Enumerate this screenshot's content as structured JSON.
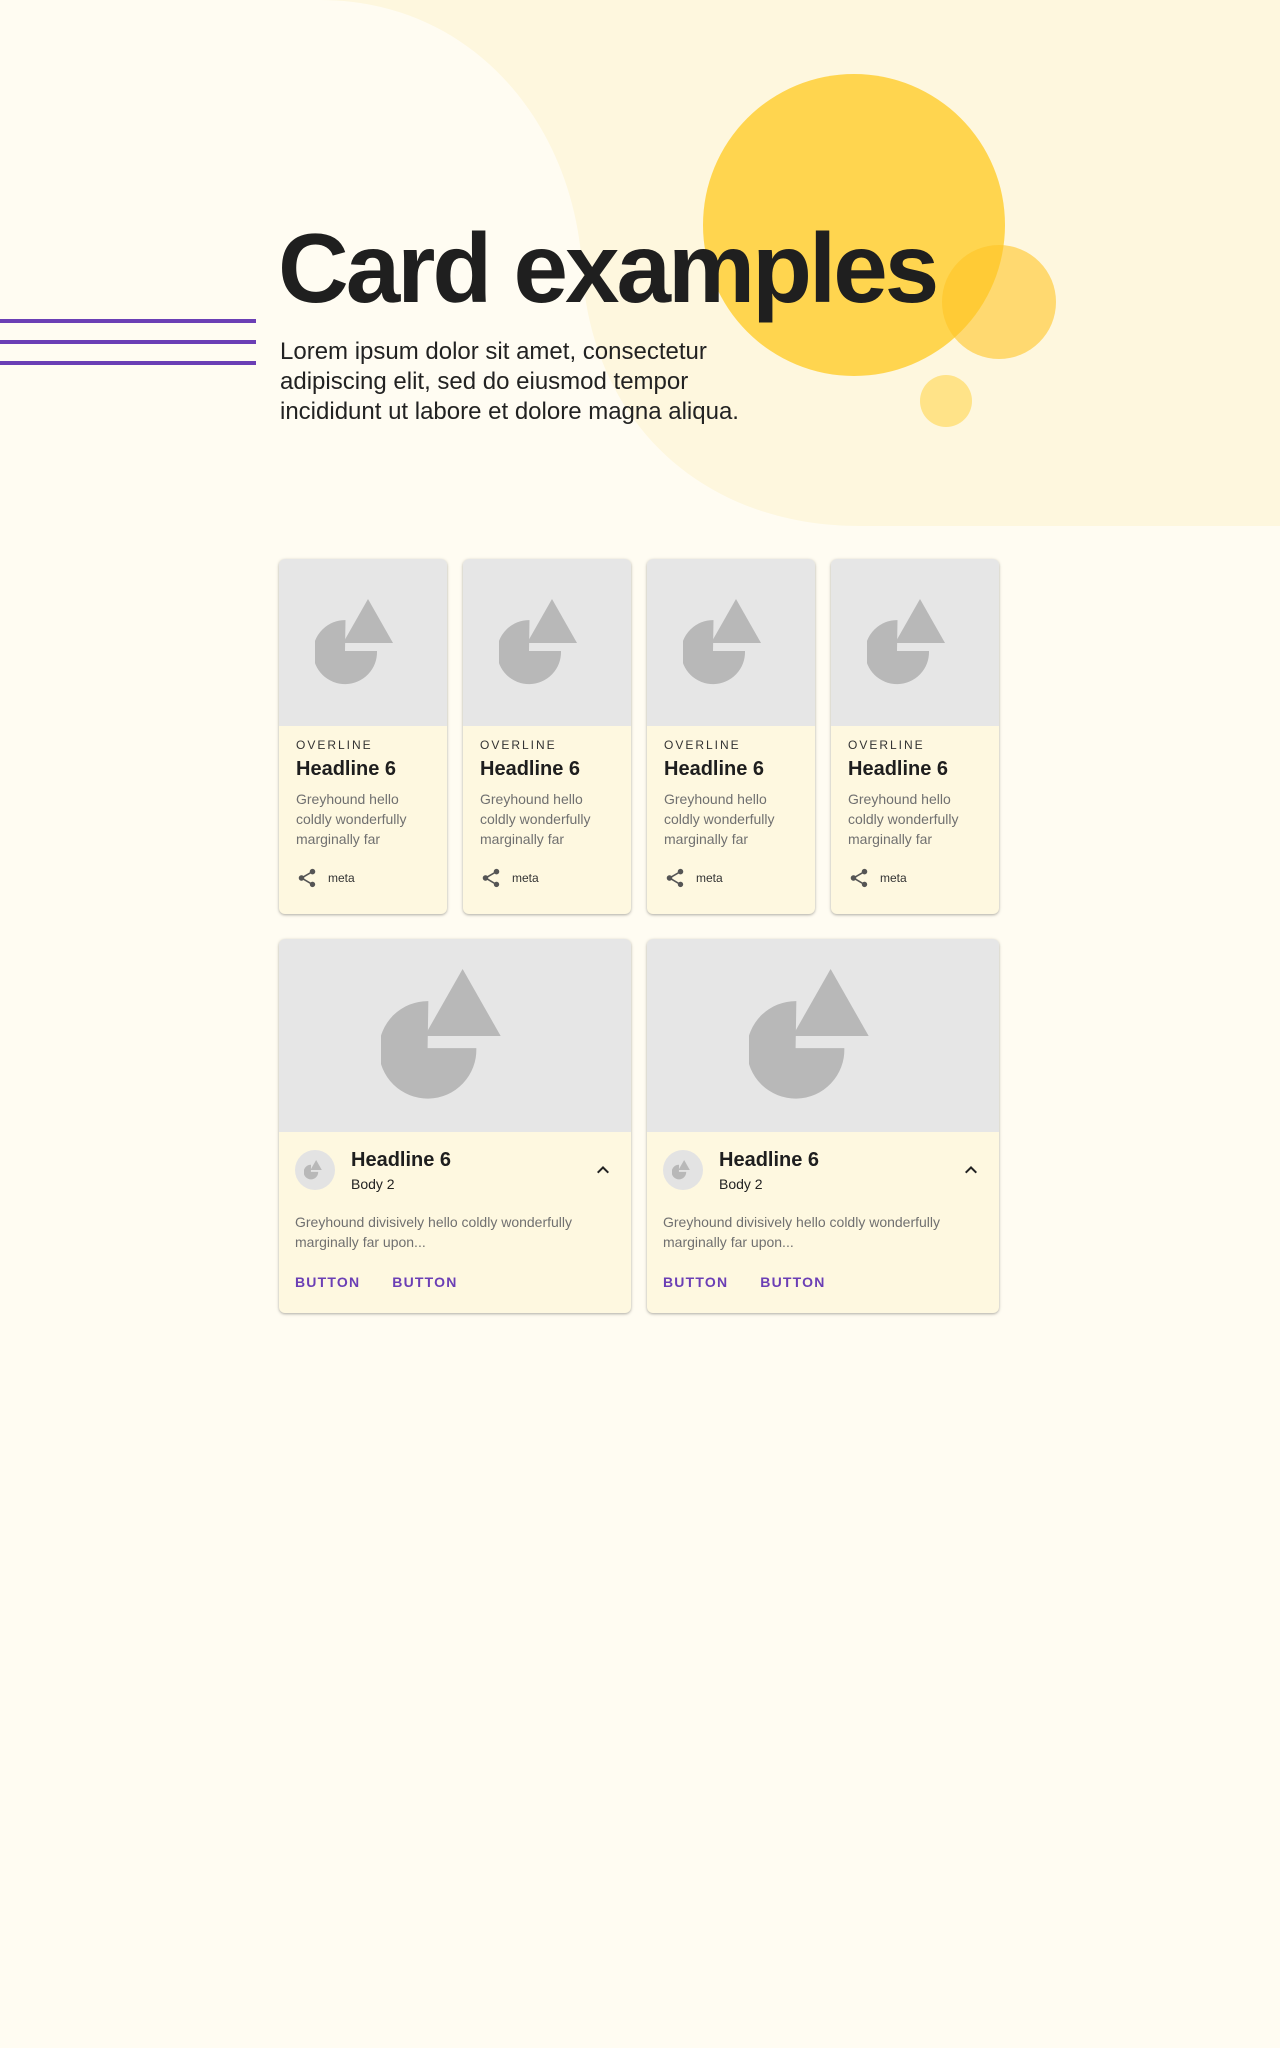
{
  "colors": {
    "page_bg": "#FFFCF2",
    "blob": "#FEF7DE",
    "accent_purple": "#6B3FB5",
    "yellow": "#FFD54F",
    "card_bg": "#FEF8E0",
    "media_bg": "#E6E6E6"
  },
  "hero": {
    "title": "Card examples",
    "description": "Lorem ipsum dolor sit amet, consectetur adipiscing elit, sed do eiusmod tempor incididunt ut labore et dolore magna aliqua."
  },
  "small_cards": [
    {
      "overline": "OVERLINE",
      "headline": "Headline 6",
      "text": "Greyhound hello coldly wonderfully marginally far",
      "meta": "meta",
      "icon": "share-icon"
    },
    {
      "overline": "OVERLINE",
      "headline": "Headline 6",
      "text": "Greyhound hello coldly wonderfully marginally far",
      "meta": "meta",
      "icon": "share-icon"
    },
    {
      "overline": "OVERLINE",
      "headline": "Headline 6",
      "text": "Greyhound hello coldly wonderfully marginally far",
      "meta": "meta",
      "icon": "share-icon"
    },
    {
      "overline": "OVERLINE",
      "headline": "Headline 6",
      "text": "Greyhound hello coldly wonderfully marginally far",
      "meta": "meta",
      "icon": "share-icon"
    }
  ],
  "wide_cards": [
    {
      "headline": "Headline 6",
      "subtitle": "Body 2",
      "text": "Greyhound divisively hello coldly wonderfully marginally far upon...",
      "button1": "BUTTON",
      "button2": "BUTTON",
      "icon": "chevron-up-icon"
    },
    {
      "headline": "Headline 6",
      "subtitle": "Body 2",
      "text": "Greyhound divisively hello coldly wonderfully marginally far upon...",
      "button1": "BUTTON",
      "button2": "BUTTON",
      "icon": "chevron-up-icon"
    }
  ]
}
